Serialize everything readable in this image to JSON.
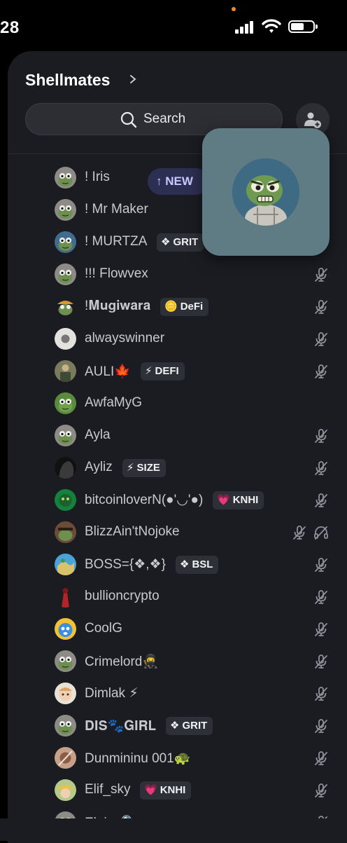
{
  "status_bar": {
    "time": "28"
  },
  "server": {
    "name": "Shellmates"
  },
  "search": {
    "label": "Search"
  },
  "new_pill": {
    "label": "↑ NEW"
  },
  "colors": {
    "panel": "#1b1c21",
    "tag_bg": "#2e3037",
    "new_pill": "#2d2f52",
    "popup": "#5f7c85"
  },
  "members": [
    {
      "name": "! Iris",
      "avatar": "frog-grey",
      "tag": "",
      "tag_icon": "",
      "muted": false
    },
    {
      "name": "! Mr Maker",
      "avatar": "frog-grey",
      "tag": "",
      "tag_icon": "",
      "muted": false
    },
    {
      "name": "! MURTZA",
      "avatar": "frog-blue",
      "tag": "GRIT",
      "tag_icon": "❖",
      "muted": false
    },
    {
      "name": "!!! Flowvex",
      "avatar": "frog-grey",
      "tag": "",
      "tag_icon": "",
      "muted": true
    },
    {
      "name": "!𝐌𝐮𝐠𝐢𝐰𝐚𝐫𝐚",
      "avatar": "frog-hat",
      "tag": "DeFi",
      "tag_icon": "🪙",
      "muted": true
    },
    {
      "name": "alwayswinner",
      "avatar": "white",
      "tag": "",
      "tag_icon": "",
      "muted": true
    },
    {
      "name": "AULI🍁",
      "avatar": "photo",
      "tag": "DEFI",
      "tag_icon": "⚡",
      "muted": true
    },
    {
      "name": "AwfaMyG",
      "avatar": "frog-green",
      "tag": "",
      "tag_icon": "",
      "muted": false
    },
    {
      "name": "Ayla",
      "avatar": "frog-grey",
      "tag": "",
      "tag_icon": "",
      "muted": true
    },
    {
      "name": "Ayliz",
      "avatar": "dark",
      "tag": "SIZE",
      "tag_icon": "⚡",
      "muted": true
    },
    {
      "name": "bitcoinloverN(●'◡'●)",
      "avatar": "green",
      "tag": "KNHI",
      "tag_icon": "💗",
      "muted": true
    },
    {
      "name": "BlizzAin'tNojoke",
      "avatar": "brown",
      "tag": "",
      "tag_icon": "",
      "muted": true,
      "deafened": true
    },
    {
      "name": "BOSS={❖,❖}",
      "avatar": "map",
      "tag": "BSL",
      "tag_icon": "❖",
      "muted": true
    },
    {
      "name": "bullioncrypto",
      "avatar": "red",
      "tag": "",
      "tag_icon": "",
      "muted": true
    },
    {
      "name": "CoolG",
      "avatar": "yellow",
      "tag": "",
      "tag_icon": "",
      "muted": true
    },
    {
      "name": "Crimelord🥷",
      "avatar": "frog-grey",
      "tag": "",
      "tag_icon": "",
      "muted": true
    },
    {
      "name": "Dimlak ⚡",
      "avatar": "cartoon",
      "tag": "",
      "tag_icon": "",
      "muted": true
    },
    {
      "name": "𝐃𝐈𝐒🐾𝐆𝐈𝐑𝐋",
      "avatar": "frog-grey",
      "tag": "GRIT",
      "tag_icon": "❖",
      "muted": true
    },
    {
      "name": "Dunmininu 001🐢",
      "avatar": "photo2",
      "tag": "",
      "tag_icon": "",
      "muted": true
    },
    {
      "name": "Elif_sky",
      "avatar": "hat",
      "tag": "KNHI",
      "tag_icon": "💗",
      "muted": true
    },
    {
      "name": "Eloise🔍",
      "avatar": "frog-grey",
      "tag": "",
      "tag_icon": "",
      "muted": true
    }
  ]
}
